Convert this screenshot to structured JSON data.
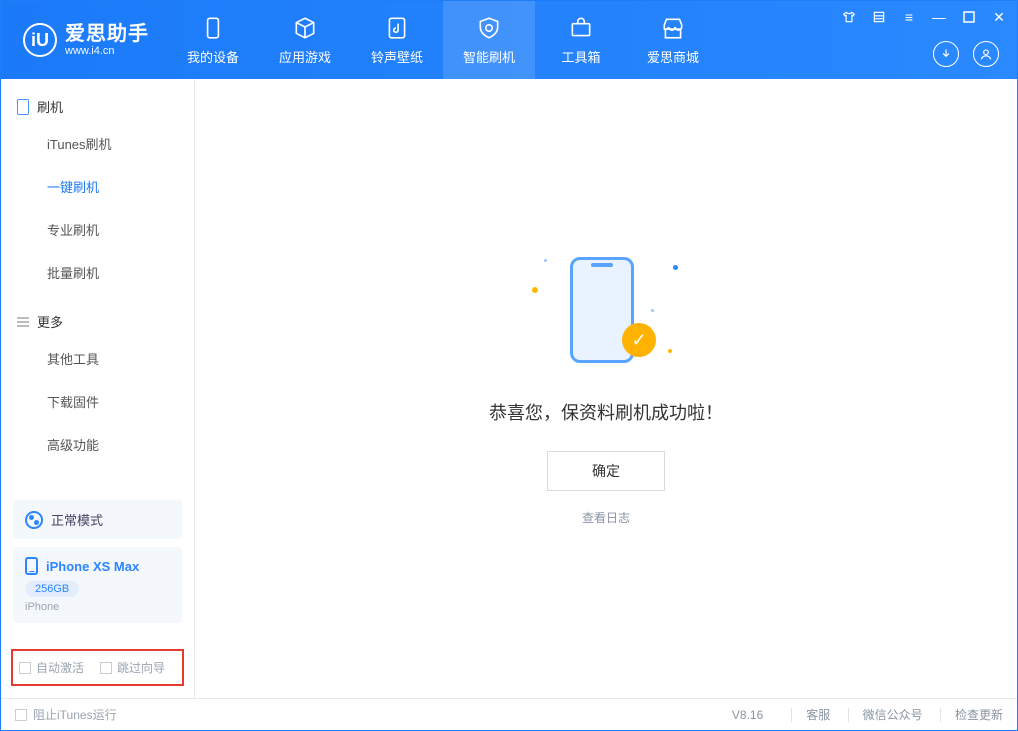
{
  "app": {
    "title": "爱思助手",
    "url": "www.i4.cn"
  },
  "nav": {
    "tabs": [
      {
        "label": "我的设备"
      },
      {
        "label": "应用游戏"
      },
      {
        "label": "铃声壁纸"
      },
      {
        "label": "智能刷机",
        "active": true
      },
      {
        "label": "工具箱"
      },
      {
        "label": "爱思商城"
      }
    ]
  },
  "sidebar": {
    "section1": {
      "title": "刷机",
      "items": [
        "iTunes刷机",
        "一键刷机",
        "专业刷机",
        "批量刷机"
      ],
      "activeIndex": 1
    },
    "section2": {
      "title": "更多",
      "items": [
        "其他工具",
        "下载固件",
        "高级功能"
      ]
    },
    "mode": "正常模式",
    "device": {
      "name": "iPhone XS Max",
      "storage": "256GB",
      "type": "iPhone"
    },
    "options": {
      "autoActivate": "自动激活",
      "skipWizard": "跳过向导"
    }
  },
  "main": {
    "message": "恭喜您，保资料刷机成功啦！",
    "okButton": "确定",
    "logLink": "查看日志"
  },
  "footer": {
    "preventItunes": "阻止iTunes运行",
    "version": "V8.16",
    "links": [
      "客服",
      "微信公众号",
      "检查更新"
    ]
  }
}
